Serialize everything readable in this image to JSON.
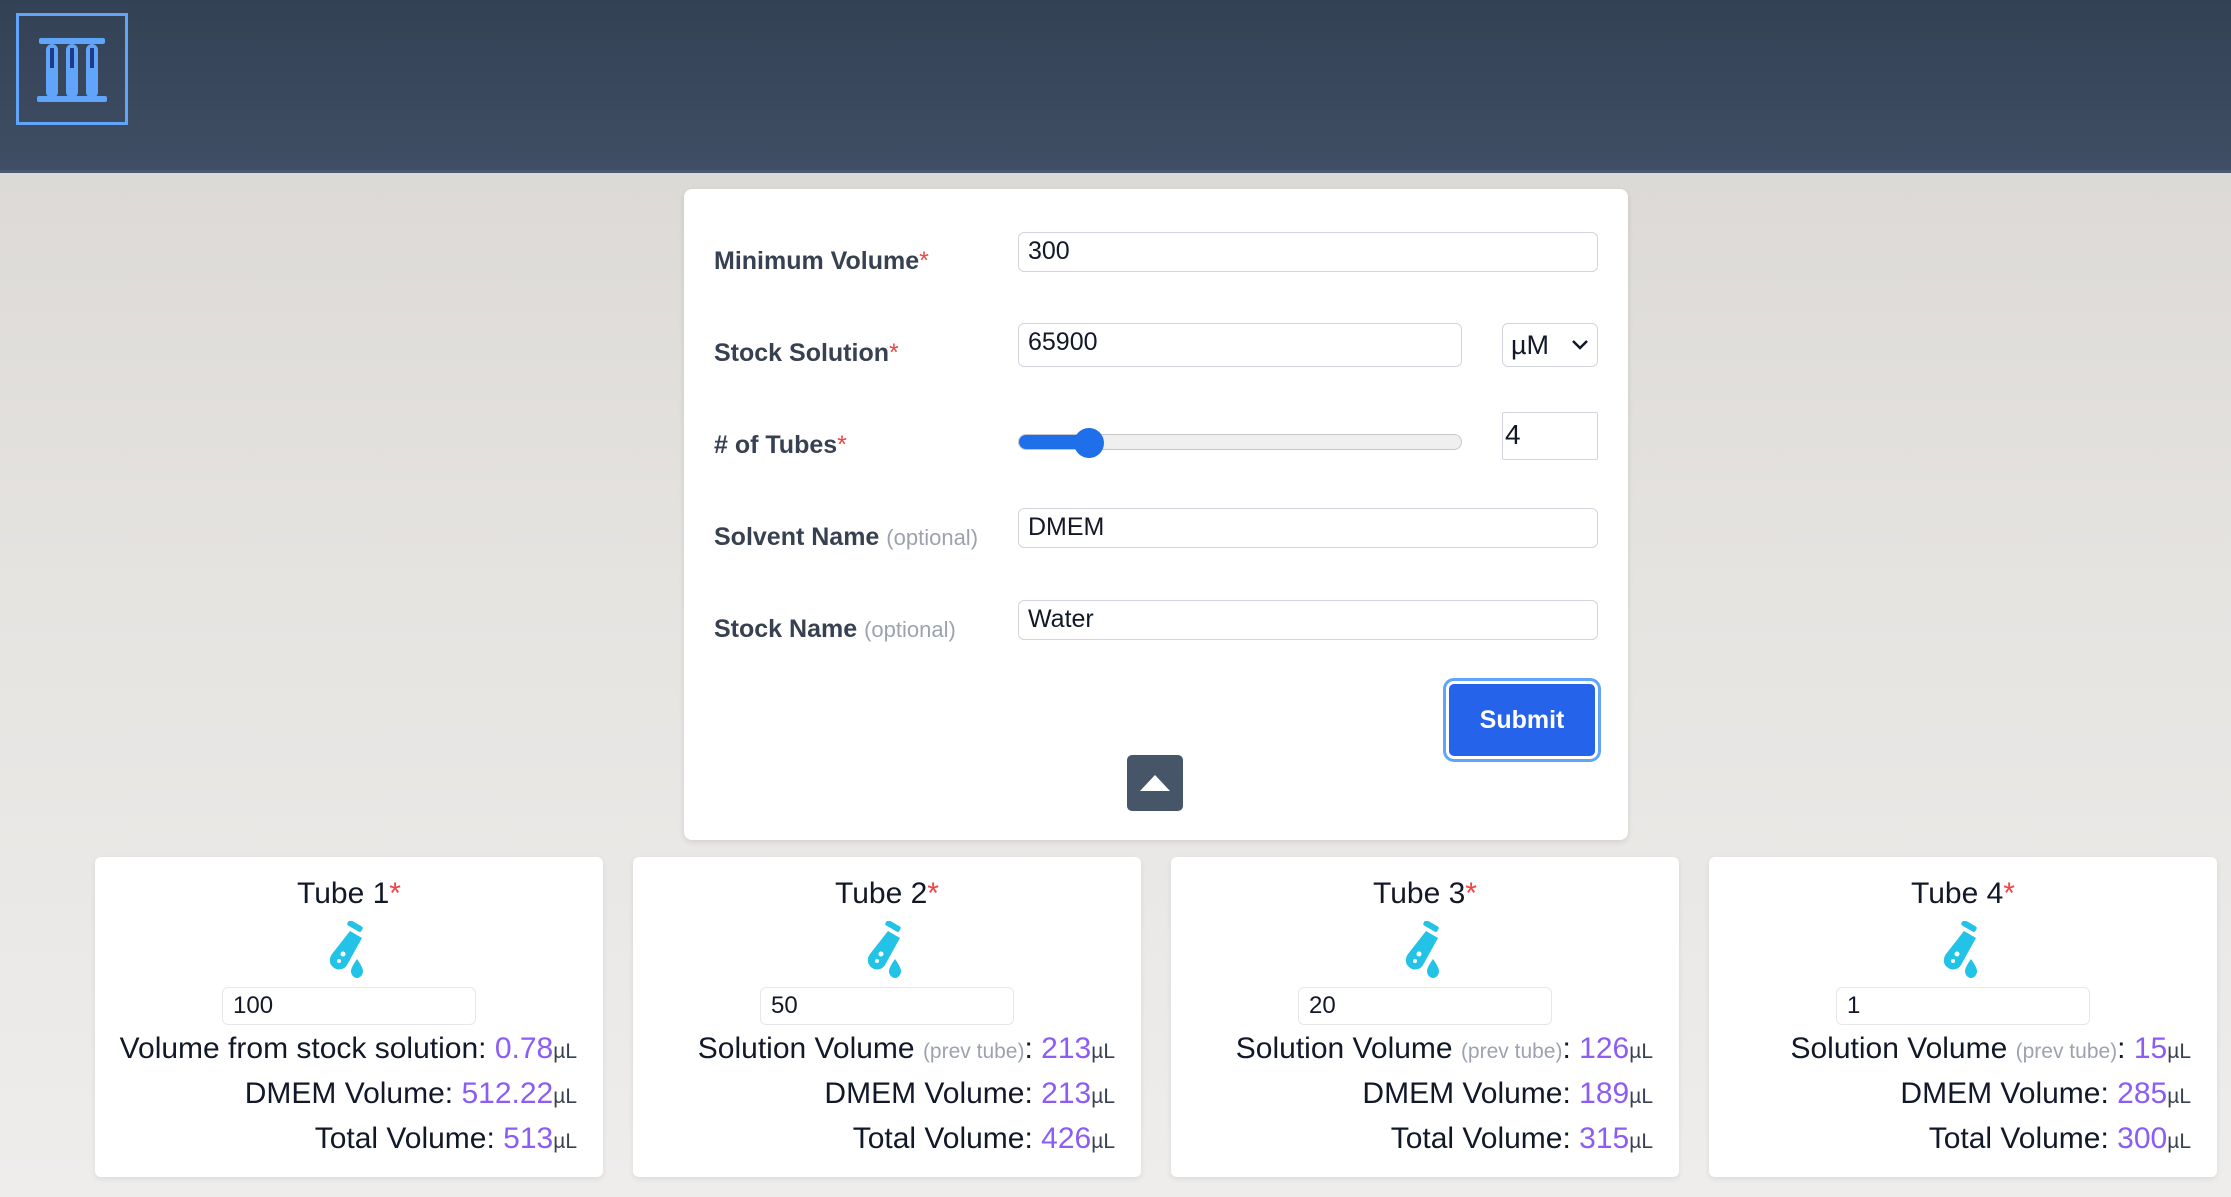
{
  "header": {
    "logo_icon": "test-tubes-rack-icon"
  },
  "form": {
    "min_volume": {
      "label": "Minimum Volume",
      "required": "*",
      "value": "300"
    },
    "stock_solution": {
      "label": "Stock Solution",
      "required": "*",
      "value": "65900",
      "unit_selected": "µM"
    },
    "tubes": {
      "label": "# of Tubes",
      "required": "*",
      "value": "4",
      "slider_fraction": 0.16
    },
    "solvent_name": {
      "label": "Solvent Name",
      "optional": "(optional)",
      "value": "DMEM"
    },
    "stock_name": {
      "label": "Stock Name",
      "optional": "(optional)",
      "value": "Water"
    },
    "submit_label": "Submit",
    "collapse_icon": "triangle-up-icon"
  },
  "tubes": [
    {
      "title": "Tube 1",
      "required": "*",
      "dilution": "100",
      "line1_label": "Volume from stock solution: ",
      "line1_prev": "",
      "line1_colon": "",
      "line1_value": "0.78",
      "solvent_label": "DMEM Volume: ",
      "solvent_value": "512.22",
      "total_label": "Total Volume: ",
      "total_value": "513",
      "unit": "µL"
    },
    {
      "title": "Tube 2",
      "required": "*",
      "dilution": "50",
      "line1_label": "Solution Volume ",
      "line1_prev": "(prev tube)",
      "line1_colon": ": ",
      "line1_value": "213",
      "solvent_label": "DMEM Volume: ",
      "solvent_value": "213",
      "total_label": "Total Volume: ",
      "total_value": "426",
      "unit": "µL"
    },
    {
      "title": "Tube 3",
      "required": "*",
      "dilution": "20",
      "line1_label": "Solution Volume ",
      "line1_prev": "(prev tube)",
      "line1_colon": ": ",
      "line1_value": "126",
      "solvent_label": "DMEM Volume: ",
      "solvent_value": "189",
      "total_label": "Total Volume: ",
      "total_value": "315",
      "unit": "µL"
    },
    {
      "title": "Tube 4",
      "required": "*",
      "dilution": "1",
      "line1_label": "Solution Volume ",
      "line1_prev": "(prev tube)",
      "line1_colon": ": ",
      "line1_value": "15",
      "solvent_label": "DMEM Volume: ",
      "solvent_value": "285",
      "total_label": "Total Volume: ",
      "total_value": "300",
      "unit": "µL"
    }
  ],
  "colors": {
    "accent": "#2563eb",
    "value": "#8b5cf6",
    "required": "#ef4444",
    "header": "#3a4a60",
    "tube_icon": "#22c3e6"
  }
}
